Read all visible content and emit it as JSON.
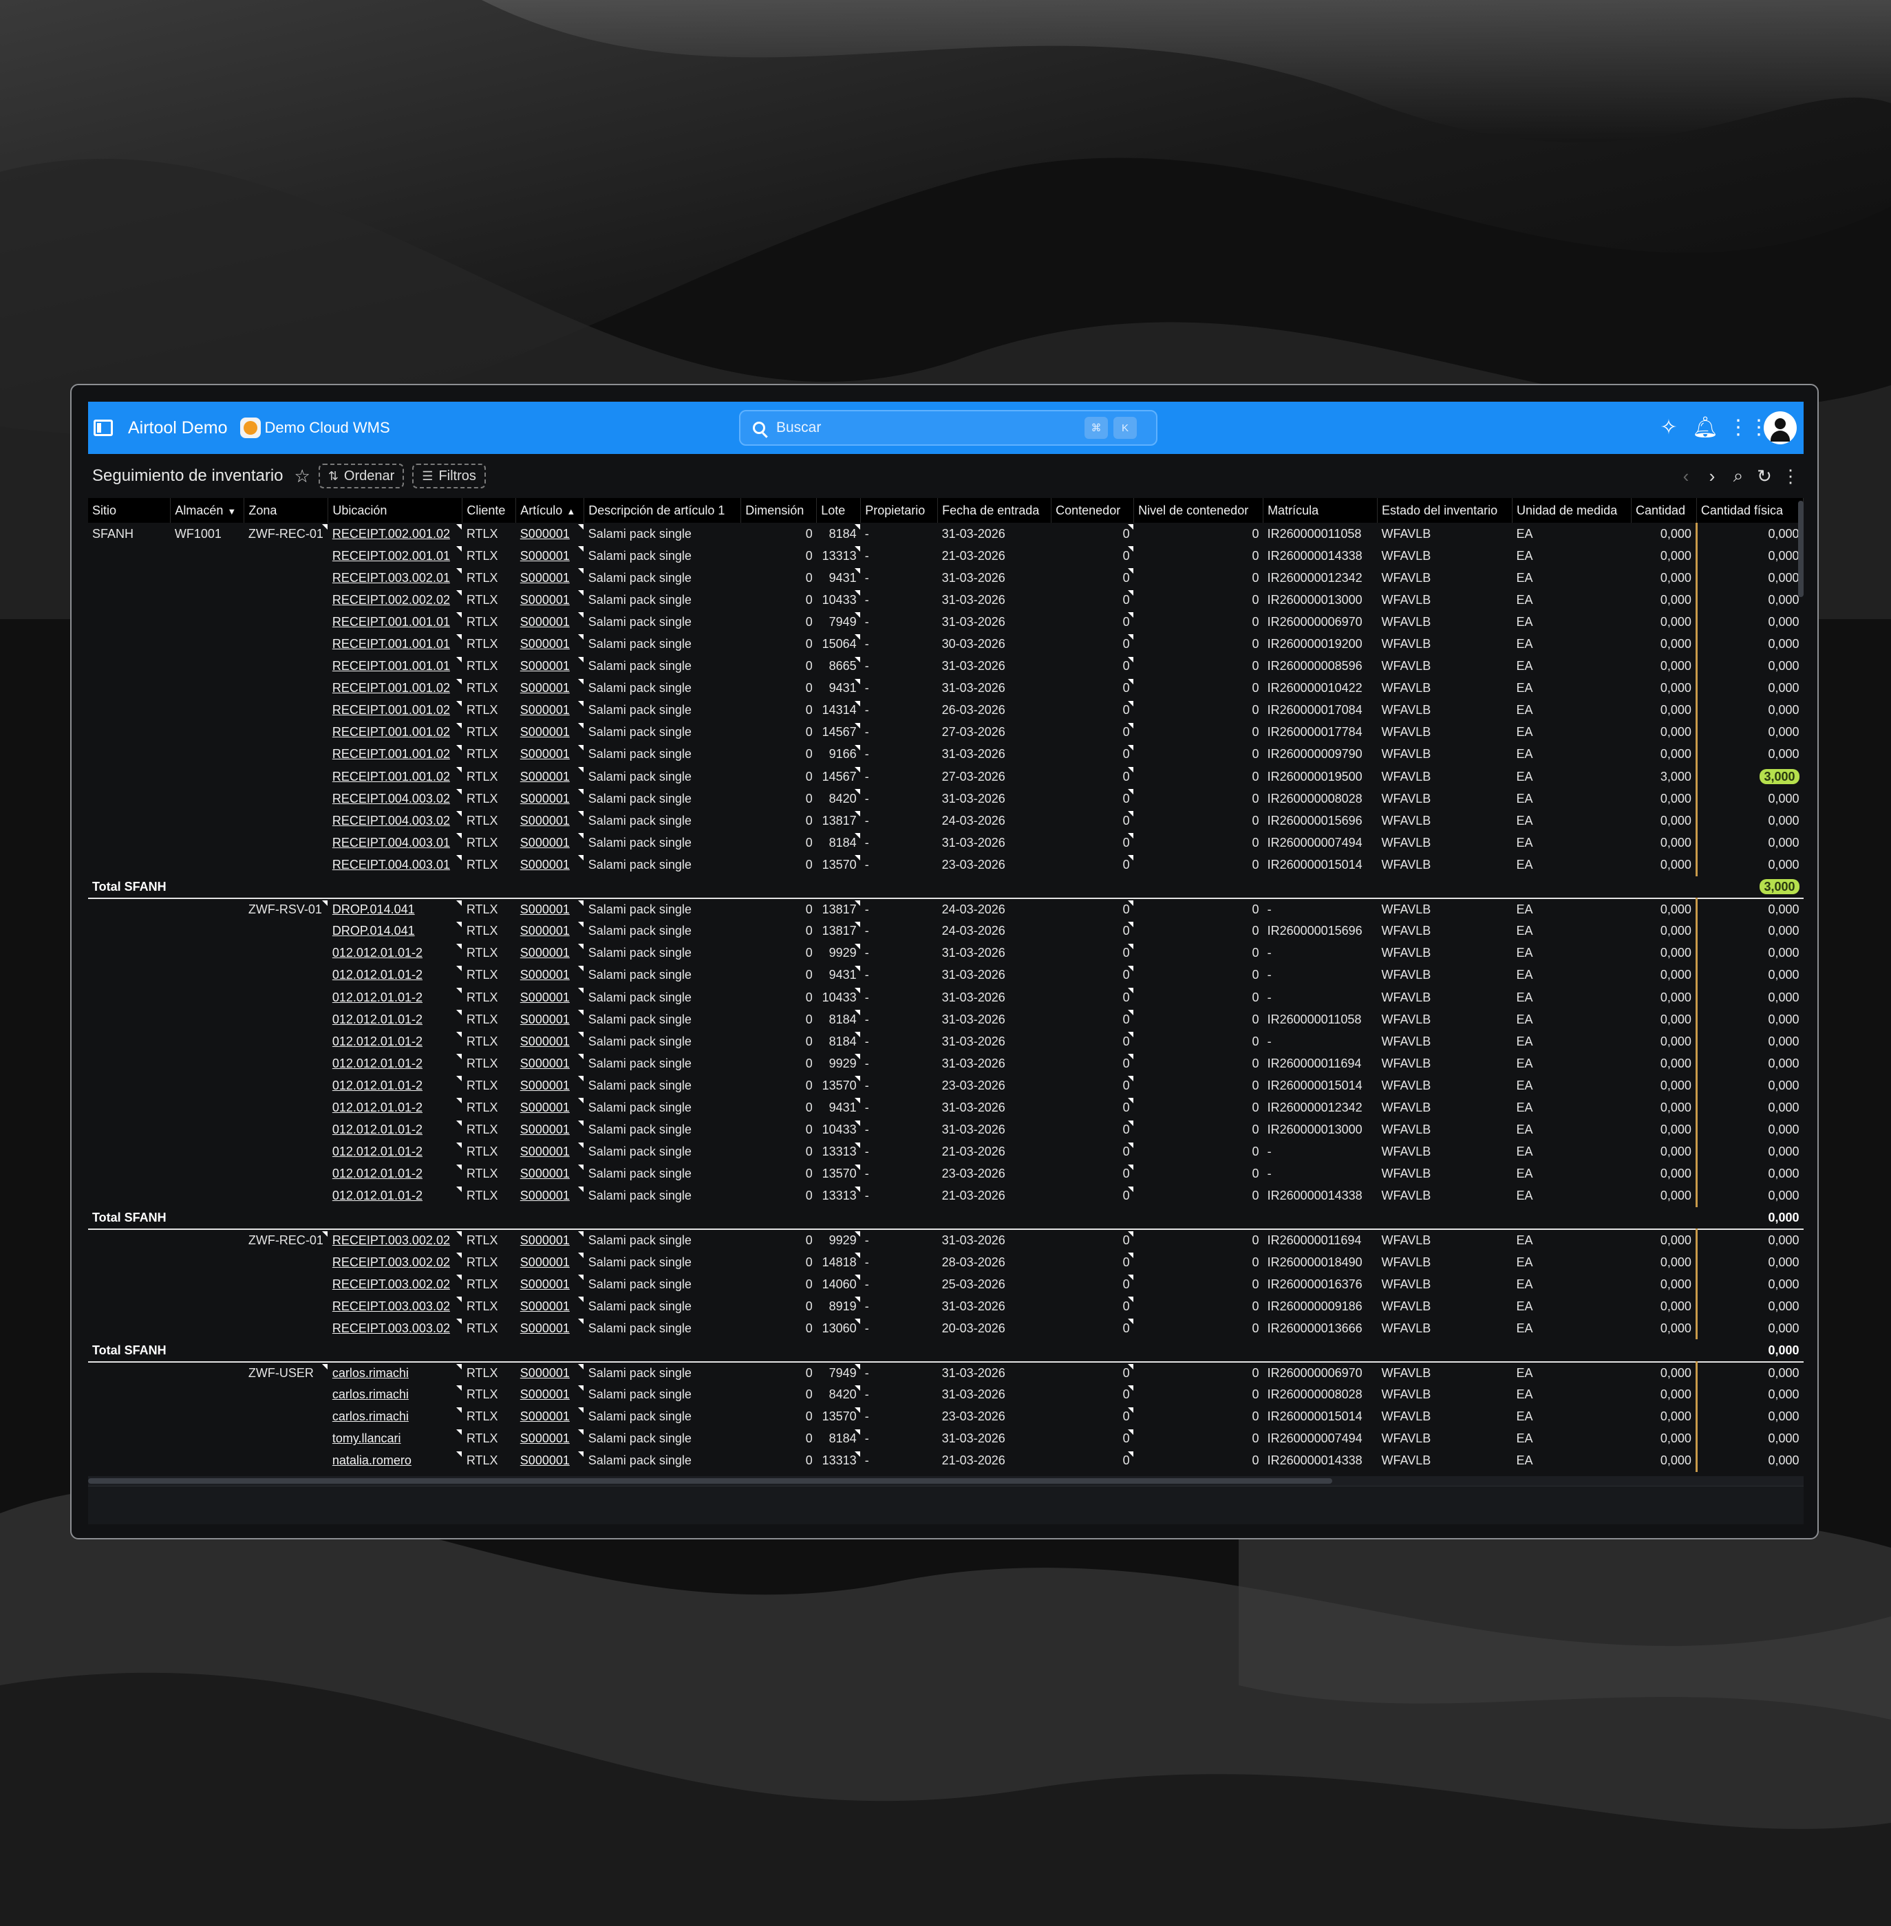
{
  "app": {
    "title": "Airtool Demo",
    "subtitle": "Demo Cloud WMS"
  },
  "search": {
    "placeholder": "Buscar",
    "kbd1": "⌘",
    "kbd2": "K"
  },
  "page": {
    "title": "Seguimiento de inventario",
    "sort_label": "Ordenar",
    "filter_label": "Filtros"
  },
  "columns": [
    "Sitio",
    "Almacén",
    "Zona",
    "Ubicación",
    "Cliente",
    "Artículo",
    "Descripción de artículo 1",
    "Dimensión",
    "Lote",
    "Propietario",
    "Fecha de entrada",
    "Contenedor",
    "Nivel de contenedor",
    "Matrícula",
    "Estado del inventario",
    "Unidad de medida",
    "Cantidad",
    "Cantidad física"
  ],
  "rows": [
    {
      "type": "row",
      "sitio": "SFANH",
      "almacen": "WF1001",
      "zona": "ZWF-REC-01",
      "ubicacion": "RECEIPT.002.001.02",
      "cliente": "RTLX",
      "articulo": "S000001",
      "descripcion": "Salami pack single",
      "dimension": "0",
      "lote": "8184",
      "propietario": "-",
      "fecha": "31-03-2026",
      "contenedor": "0",
      "nivel": "0",
      "matricula": "IR260000011058",
      "estado": "WFAVLB",
      "unidad": "EA",
      "cantidad": "0,000",
      "fisica": "0,000"
    },
    {
      "type": "row",
      "ubicacion": "RECEIPT.002.001.01",
      "cliente": "RTLX",
      "articulo": "S000001",
      "descripcion": "Salami pack single",
      "dimension": "0",
      "lote": "13313",
      "propietario": "-",
      "fecha": "21-03-2026",
      "contenedor": "0",
      "nivel": "0",
      "matricula": "IR260000014338",
      "estado": "WFAVLB",
      "unidad": "EA",
      "cantidad": "0,000",
      "fisica": "0,000"
    },
    {
      "type": "row",
      "ubicacion": "RECEIPT.003.002.01",
      "cliente": "RTLX",
      "articulo": "S000001",
      "descripcion": "Salami pack single",
      "dimension": "0",
      "lote": "9431",
      "propietario": "-",
      "fecha": "31-03-2026",
      "contenedor": "0",
      "nivel": "0",
      "matricula": "IR260000012342",
      "estado": "WFAVLB",
      "unidad": "EA",
      "cantidad": "0,000",
      "fisica": "0,000"
    },
    {
      "type": "row",
      "ubicacion": "RECEIPT.002.002.02",
      "cliente": "RTLX",
      "articulo": "S000001",
      "descripcion": "Salami pack single",
      "dimension": "0",
      "lote": "10433",
      "propietario": "-",
      "fecha": "31-03-2026",
      "contenedor": "0",
      "nivel": "0",
      "matricula": "IR260000013000",
      "estado": "WFAVLB",
      "unidad": "EA",
      "cantidad": "0,000",
      "fisica": "0,000"
    },
    {
      "type": "row",
      "ubicacion": "RECEIPT.001.001.01",
      "cliente": "RTLX",
      "articulo": "S000001",
      "descripcion": "Salami pack single",
      "dimension": "0",
      "lote": "7949",
      "propietario": "-",
      "fecha": "31-03-2026",
      "contenedor": "0",
      "nivel": "0",
      "matricula": "IR260000006970",
      "estado": "WFAVLB",
      "unidad": "EA",
      "cantidad": "0,000",
      "fisica": "0,000"
    },
    {
      "type": "row",
      "ubicacion": "RECEIPT.001.001.01",
      "cliente": "RTLX",
      "articulo": "S000001",
      "descripcion": "Salami pack single",
      "dimension": "0",
      "lote": "15064",
      "propietario": "-",
      "fecha": "30-03-2026",
      "contenedor": "0",
      "nivel": "0",
      "matricula": "IR260000019200",
      "estado": "WFAVLB",
      "unidad": "EA",
      "cantidad": "0,000",
      "fisica": "0,000"
    },
    {
      "type": "row",
      "ubicacion": "RECEIPT.001.001.01",
      "cliente": "RTLX",
      "articulo": "S000001",
      "descripcion": "Salami pack single",
      "dimension": "0",
      "lote": "8665",
      "propietario": "-",
      "fecha": "31-03-2026",
      "contenedor": "0",
      "nivel": "0",
      "matricula": "IR260000008596",
      "estado": "WFAVLB",
      "unidad": "EA",
      "cantidad": "0,000",
      "fisica": "0,000"
    },
    {
      "type": "row",
      "ubicacion": "RECEIPT.001.001.02",
      "cliente": "RTLX",
      "articulo": "S000001",
      "descripcion": "Salami pack single",
      "dimension": "0",
      "lote": "9431",
      "propietario": "-",
      "fecha": "31-03-2026",
      "contenedor": "0",
      "nivel": "0",
      "matricula": "IR260000010422",
      "estado": "WFAVLB",
      "unidad": "EA",
      "cantidad": "0,000",
      "fisica": "0,000"
    },
    {
      "type": "row",
      "ubicacion": "RECEIPT.001.001.02",
      "cliente": "RTLX",
      "articulo": "S000001",
      "descripcion": "Salami pack single",
      "dimension": "0",
      "lote": "14314",
      "propietario": "-",
      "fecha": "26-03-2026",
      "contenedor": "0",
      "nivel": "0",
      "matricula": "IR260000017084",
      "estado": "WFAVLB",
      "unidad": "EA",
      "cantidad": "0,000",
      "fisica": "0,000"
    },
    {
      "type": "row",
      "ubicacion": "RECEIPT.001.001.02",
      "cliente": "RTLX",
      "articulo": "S000001",
      "descripcion": "Salami pack single",
      "dimension": "0",
      "lote": "14567",
      "propietario": "-",
      "fecha": "27-03-2026",
      "contenedor": "0",
      "nivel": "0",
      "matricula": "IR260000017784",
      "estado": "WFAVLB",
      "unidad": "EA",
      "cantidad": "0,000",
      "fisica": "0,000"
    },
    {
      "type": "row",
      "ubicacion": "RECEIPT.001.001.02",
      "cliente": "RTLX",
      "articulo": "S000001",
      "descripcion": "Salami pack single",
      "dimension": "0",
      "lote": "9166",
      "propietario": "-",
      "fecha": "31-03-2026",
      "contenedor": "0",
      "nivel": "0",
      "matricula": "IR260000009790",
      "estado": "WFAVLB",
      "unidad": "EA",
      "cantidad": "0,000",
      "fisica": "0,000"
    },
    {
      "type": "row",
      "ubicacion": "RECEIPT.001.001.02",
      "cliente": "RTLX",
      "articulo": "S000001",
      "descripcion": "Salami pack single",
      "dimension": "0",
      "lote": "14567",
      "propietario": "-",
      "fecha": "27-03-2026",
      "contenedor": "0",
      "nivel": "0",
      "matricula": "IR260000019500",
      "estado": "WFAVLB",
      "unidad": "EA",
      "cantidad": "3,000",
      "fisica": "3,000",
      "highlight": true
    },
    {
      "type": "row",
      "ubicacion": "RECEIPT.004.003.02",
      "cliente": "RTLX",
      "articulo": "S000001",
      "descripcion": "Salami pack single",
      "dimension": "0",
      "lote": "8420",
      "propietario": "-",
      "fecha": "31-03-2026",
      "contenedor": "0",
      "nivel": "0",
      "matricula": "IR260000008028",
      "estado": "WFAVLB",
      "unidad": "EA",
      "cantidad": "0,000",
      "fisica": "0,000"
    },
    {
      "type": "row",
      "ubicacion": "RECEIPT.004.003.02",
      "cliente": "RTLX",
      "articulo": "S000001",
      "descripcion": "Salami pack single",
      "dimension": "0",
      "lote": "13817",
      "propietario": "-",
      "fecha": "24-03-2026",
      "contenedor": "0",
      "nivel": "0",
      "matricula": "IR260000015696",
      "estado": "WFAVLB",
      "unidad": "EA",
      "cantidad": "0,000",
      "fisica": "0,000"
    },
    {
      "type": "row",
      "ubicacion": "RECEIPT.004.003.01",
      "cliente": "RTLX",
      "articulo": "S000001",
      "descripcion": "Salami pack single",
      "dimension": "0",
      "lote": "8184",
      "propietario": "-",
      "fecha": "31-03-2026",
      "contenedor": "0",
      "nivel": "0",
      "matricula": "IR260000007494",
      "estado": "WFAVLB",
      "unidad": "EA",
      "cantidad": "0,000",
      "fisica": "0,000"
    },
    {
      "type": "row",
      "ubicacion": "RECEIPT.004.003.01",
      "cliente": "RTLX",
      "articulo": "S000001",
      "descripcion": "Salami pack single",
      "dimension": "0",
      "lote": "13570",
      "propietario": "-",
      "fecha": "23-03-2026",
      "contenedor": "0",
      "nivel": "0",
      "matricula": "IR260000015014",
      "estado": "WFAVLB",
      "unidad": "EA",
      "cantidad": "0,000",
      "fisica": "0,000"
    },
    {
      "type": "total",
      "label": "Total SFANH",
      "fisica": "3,000",
      "highlight": true
    },
    {
      "type": "row",
      "zona": "ZWF-RSV-01",
      "ubicacion": "DROP.014.041",
      "cliente": "RTLX",
      "articulo": "S000001",
      "descripcion": "Salami pack single",
      "dimension": "0",
      "lote": "13817",
      "propietario": "-",
      "fecha": "24-03-2026",
      "contenedor": "0",
      "nivel": "0",
      "matricula": "-",
      "estado": "WFAVLB",
      "unidad": "EA",
      "cantidad": "0,000",
      "fisica": "0,000"
    },
    {
      "type": "row",
      "ubicacion": "DROP.014.041",
      "cliente": "RTLX",
      "articulo": "S000001",
      "descripcion": "Salami pack single",
      "dimension": "0",
      "lote": "13817",
      "propietario": "-",
      "fecha": "24-03-2026",
      "contenedor": "0",
      "nivel": "0",
      "matricula": "IR260000015696",
      "estado": "WFAVLB",
      "unidad": "EA",
      "cantidad": "0,000",
      "fisica": "0,000"
    },
    {
      "type": "row",
      "ubicacion": "012.012.01.01-2",
      "cliente": "RTLX",
      "articulo": "S000001",
      "descripcion": "Salami pack single",
      "dimension": "0",
      "lote": "9929",
      "propietario": "-",
      "fecha": "31-03-2026",
      "contenedor": "0",
      "nivel": "0",
      "matricula": "-",
      "estado": "WFAVLB",
      "unidad": "EA",
      "cantidad": "0,000",
      "fisica": "0,000"
    },
    {
      "type": "row",
      "ubicacion": "012.012.01.01-2",
      "cliente": "RTLX",
      "articulo": "S000001",
      "descripcion": "Salami pack single",
      "dimension": "0",
      "lote": "9431",
      "propietario": "-",
      "fecha": "31-03-2026",
      "contenedor": "0",
      "nivel": "0",
      "matricula": "-",
      "estado": "WFAVLB",
      "unidad": "EA",
      "cantidad": "0,000",
      "fisica": "0,000"
    },
    {
      "type": "row",
      "ubicacion": "012.012.01.01-2",
      "cliente": "RTLX",
      "articulo": "S000001",
      "descripcion": "Salami pack single",
      "dimension": "0",
      "lote": "10433",
      "propietario": "-",
      "fecha": "31-03-2026",
      "contenedor": "0",
      "nivel": "0",
      "matricula": "-",
      "estado": "WFAVLB",
      "unidad": "EA",
      "cantidad": "0,000",
      "fisica": "0,000"
    },
    {
      "type": "row",
      "ubicacion": "012.012.01.01-2",
      "cliente": "RTLX",
      "articulo": "S000001",
      "descripcion": "Salami pack single",
      "dimension": "0",
      "lote": "8184",
      "propietario": "-",
      "fecha": "31-03-2026",
      "contenedor": "0",
      "nivel": "0",
      "matricula": "IR260000011058",
      "estado": "WFAVLB",
      "unidad": "EA",
      "cantidad": "0,000",
      "fisica": "0,000"
    },
    {
      "type": "row",
      "ubicacion": "012.012.01.01-2",
      "cliente": "RTLX",
      "articulo": "S000001",
      "descripcion": "Salami pack single",
      "dimension": "0",
      "lote": "8184",
      "propietario": "-",
      "fecha": "31-03-2026",
      "contenedor": "0",
      "nivel": "0",
      "matricula": "-",
      "estado": "WFAVLB",
      "unidad": "EA",
      "cantidad": "0,000",
      "fisica": "0,000"
    },
    {
      "type": "row",
      "ubicacion": "012.012.01.01-2",
      "cliente": "RTLX",
      "articulo": "S000001",
      "descripcion": "Salami pack single",
      "dimension": "0",
      "lote": "9929",
      "propietario": "-",
      "fecha": "31-03-2026",
      "contenedor": "0",
      "nivel": "0",
      "matricula": "IR260000011694",
      "estado": "WFAVLB",
      "unidad": "EA",
      "cantidad": "0,000",
      "fisica": "0,000"
    },
    {
      "type": "row",
      "ubicacion": "012.012.01.01-2",
      "cliente": "RTLX",
      "articulo": "S000001",
      "descripcion": "Salami pack single",
      "dimension": "0",
      "lote": "13570",
      "propietario": "-",
      "fecha": "23-03-2026",
      "contenedor": "0",
      "nivel": "0",
      "matricula": "IR260000015014",
      "estado": "WFAVLB",
      "unidad": "EA",
      "cantidad": "0,000",
      "fisica": "0,000"
    },
    {
      "type": "row",
      "ubicacion": "012.012.01.01-2",
      "cliente": "RTLX",
      "articulo": "S000001",
      "descripcion": "Salami pack single",
      "dimension": "0",
      "lote": "9431",
      "propietario": "-",
      "fecha": "31-03-2026",
      "contenedor": "0",
      "nivel": "0",
      "matricula": "IR260000012342",
      "estado": "WFAVLB",
      "unidad": "EA",
      "cantidad": "0,000",
      "fisica": "0,000"
    },
    {
      "type": "row",
      "ubicacion": "012.012.01.01-2",
      "cliente": "RTLX",
      "articulo": "S000001",
      "descripcion": "Salami pack single",
      "dimension": "0",
      "lote": "10433",
      "propietario": "-",
      "fecha": "31-03-2026",
      "contenedor": "0",
      "nivel": "0",
      "matricula": "IR260000013000",
      "estado": "WFAVLB",
      "unidad": "EA",
      "cantidad": "0,000",
      "fisica": "0,000"
    },
    {
      "type": "row",
      "ubicacion": "012.012.01.01-2",
      "cliente": "RTLX",
      "articulo": "S000001",
      "descripcion": "Salami pack single",
      "dimension": "0",
      "lote": "13313",
      "propietario": "-",
      "fecha": "21-03-2026",
      "contenedor": "0",
      "nivel": "0",
      "matricula": "-",
      "estado": "WFAVLB",
      "unidad": "EA",
      "cantidad": "0,000",
      "fisica": "0,000"
    },
    {
      "type": "row",
      "ubicacion": "012.012.01.01-2",
      "cliente": "RTLX",
      "articulo": "S000001",
      "descripcion": "Salami pack single",
      "dimension": "0",
      "lote": "13570",
      "propietario": "-",
      "fecha": "23-03-2026",
      "contenedor": "0",
      "nivel": "0",
      "matricula": "-",
      "estado": "WFAVLB",
      "unidad": "EA",
      "cantidad": "0,000",
      "fisica": "0,000"
    },
    {
      "type": "row",
      "ubicacion": "012.012.01.01-2",
      "cliente": "RTLX",
      "articulo": "S000001",
      "descripcion": "Salami pack single",
      "dimension": "0",
      "lote": "13313",
      "propietario": "-",
      "fecha": "21-03-2026",
      "contenedor": "0",
      "nivel": "0",
      "matricula": "IR260000014338",
      "estado": "WFAVLB",
      "unidad": "EA",
      "cantidad": "0,000",
      "fisica": "0,000"
    },
    {
      "type": "total",
      "label": "Total SFANH",
      "fisica": "0,000"
    },
    {
      "type": "row",
      "zona": "ZWF-REC-01",
      "ubicacion": "RECEIPT.003.002.02",
      "cliente": "RTLX",
      "articulo": "S000001",
      "descripcion": "Salami pack single",
      "dimension": "0",
      "lote": "9929",
      "propietario": "-",
      "fecha": "31-03-2026",
      "contenedor": "0",
      "nivel": "0",
      "matricula": "IR260000011694",
      "estado": "WFAVLB",
      "unidad": "EA",
      "cantidad": "0,000",
      "fisica": "0,000"
    },
    {
      "type": "row",
      "ubicacion": "RECEIPT.003.002.02",
      "cliente": "RTLX",
      "articulo": "S000001",
      "descripcion": "Salami pack single",
      "dimension": "0",
      "lote": "14818",
      "propietario": "-",
      "fecha": "28-03-2026",
      "contenedor": "0",
      "nivel": "0",
      "matricula": "IR260000018490",
      "estado": "WFAVLB",
      "unidad": "EA",
      "cantidad": "0,000",
      "fisica": "0,000"
    },
    {
      "type": "row",
      "ubicacion": "RECEIPT.003.002.02",
      "cliente": "RTLX",
      "articulo": "S000001",
      "descripcion": "Salami pack single",
      "dimension": "0",
      "lote": "14060",
      "propietario": "-",
      "fecha": "25-03-2026",
      "contenedor": "0",
      "nivel": "0",
      "matricula": "IR260000016376",
      "estado": "WFAVLB",
      "unidad": "EA",
      "cantidad": "0,000",
      "fisica": "0,000"
    },
    {
      "type": "row",
      "ubicacion": "RECEIPT.003.003.02",
      "cliente": "RTLX",
      "articulo": "S000001",
      "descripcion": "Salami pack single",
      "dimension": "0",
      "lote": "8919",
      "propietario": "-",
      "fecha": "31-03-2026",
      "contenedor": "0",
      "nivel": "0",
      "matricula": "IR260000009186",
      "estado": "WFAVLB",
      "unidad": "EA",
      "cantidad": "0,000",
      "fisica": "0,000"
    },
    {
      "type": "row",
      "ubicacion": "RECEIPT.003.003.02",
      "cliente": "RTLX",
      "articulo": "S000001",
      "descripcion": "Salami pack single",
      "dimension": "0",
      "lote": "13060",
      "propietario": "-",
      "fecha": "20-03-2026",
      "contenedor": "0",
      "nivel": "0",
      "matricula": "IR260000013666",
      "estado": "WFAVLB",
      "unidad": "EA",
      "cantidad": "0,000",
      "fisica": "0,000"
    },
    {
      "type": "total",
      "label": "Total SFANH",
      "fisica": "0,000"
    },
    {
      "type": "row",
      "zona": "ZWF-USER",
      "ubicacion": "carlos.rimachi",
      "cliente": "RTLX",
      "articulo": "S000001",
      "descripcion": "Salami pack single",
      "dimension": "0",
      "lote": "7949",
      "propietario": "-",
      "fecha": "31-03-2026",
      "contenedor": "0",
      "nivel": "0",
      "matricula": "IR260000006970",
      "estado": "WFAVLB",
      "unidad": "EA",
      "cantidad": "0,000",
      "fisica": "0,000"
    },
    {
      "type": "row",
      "ubicacion": "carlos.rimachi",
      "cliente": "RTLX",
      "articulo": "S000001",
      "descripcion": "Salami pack single",
      "dimension": "0",
      "lote": "8420",
      "propietario": "-",
      "fecha": "31-03-2026",
      "contenedor": "0",
      "nivel": "0",
      "matricula": "IR260000008028",
      "estado": "WFAVLB",
      "unidad": "EA",
      "cantidad": "0,000",
      "fisica": "0,000"
    },
    {
      "type": "row",
      "ubicacion": "carlos.rimachi",
      "cliente": "RTLX",
      "articulo": "S000001",
      "descripcion": "Salami pack single",
      "dimension": "0",
      "lote": "13570",
      "propietario": "-",
      "fecha": "23-03-2026",
      "contenedor": "0",
      "nivel": "0",
      "matricula": "IR260000015014",
      "estado": "WFAVLB",
      "unidad": "EA",
      "cantidad": "0,000",
      "fisica": "0,000"
    },
    {
      "type": "row",
      "ubicacion": "tomy.llancari",
      "cliente": "RTLX",
      "articulo": "S000001",
      "descripcion": "Salami pack single",
      "dimension": "0",
      "lote": "8184",
      "propietario": "-",
      "fecha": "31-03-2026",
      "contenedor": "0",
      "nivel": "0",
      "matricula": "IR260000007494",
      "estado": "WFAVLB",
      "unidad": "EA",
      "cantidad": "0,000",
      "fisica": "0,000"
    },
    {
      "type": "row",
      "ubicacion": "natalia.romero",
      "cliente": "RTLX",
      "articulo": "S000001",
      "descripcion": "Salami pack single",
      "dimension": "0",
      "lote": "13313",
      "propietario": "-",
      "fecha": "21-03-2026",
      "contenedor": "0",
      "nivel": "0",
      "matricula": "IR260000014338",
      "estado": "WFAVLB",
      "unidad": "EA",
      "cantidad": "0,000",
      "fisica": "0,000"
    }
  ]
}
